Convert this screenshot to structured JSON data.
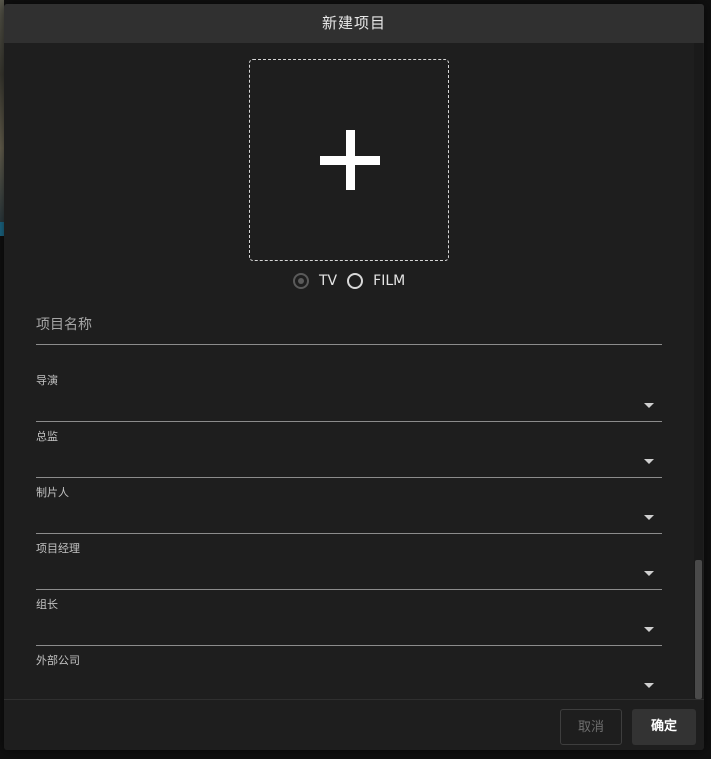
{
  "dialog": {
    "title": "新建项目"
  },
  "upload": {
    "icon": "plus-icon"
  },
  "project_type": {
    "options": [
      {
        "label": "TV",
        "checked": true
      },
      {
        "label": "FILM",
        "checked": false
      }
    ]
  },
  "fields": {
    "project_name": {
      "placeholder": "项目名称",
      "value": ""
    },
    "selects": [
      {
        "label": "导演",
        "value": ""
      },
      {
        "label": "总监",
        "value": ""
      },
      {
        "label": "制片人",
        "value": ""
      },
      {
        "label": "项目经理",
        "value": ""
      },
      {
        "label": "组长",
        "value": ""
      },
      {
        "label": "外部公司",
        "value": ""
      }
    ]
  },
  "footer": {
    "cancel_label": "取消",
    "confirm_label": "确定"
  },
  "colors": {
    "dialog_bg": "#1e1e1e",
    "header_bg": "#303030",
    "accent_text": "#ffffff",
    "disabled_text": "#6e6e6e"
  }
}
